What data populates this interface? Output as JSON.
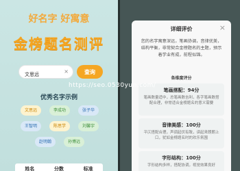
{
  "left": {
    "slogan": "好名字 好寓意",
    "title": "金榜题名测评",
    "search": {
      "value": "文思远",
      "clear_icon": "×",
      "query_label": "查询"
    },
    "examples_title": "优秀名字示例",
    "examples": [
      "文思远",
      "李成功",
      "张子华",
      "王智明",
      "陈思学",
      "刘馨宇",
      "赵明翰",
      "孙博远"
    ],
    "table_headers": [
      "姓名",
      "分数",
      "标准"
    ]
  },
  "watermark": "https://seo.0530yun.com/",
  "dialog": {
    "title": "详细评价",
    "close_icon": "×",
    "description": "您的名字寓意深远，笔画协调，音律优美，结构平衡，非常契合金榜题名的主题，预示着学业有成，前程似锦。",
    "subtitle": "各维度评分",
    "cards": [
      {
        "heading": "笔画搭配：94分",
        "body": "笔画数量适中，总笔画数吉利，各字笔画数搭配合理，非常适合金榜题名的意义需要"
      },
      {
        "heading": "音律美感：100分",
        "body": "平仄搭配合理，声调起伏有致，读起来朗朗上口，犹如金榜题名时的欢乐氛围"
      },
      {
        "heading": "字形结构：100分",
        "body": "字形结构多样，搭配协调，视觉效果良好"
      }
    ]
  }
}
